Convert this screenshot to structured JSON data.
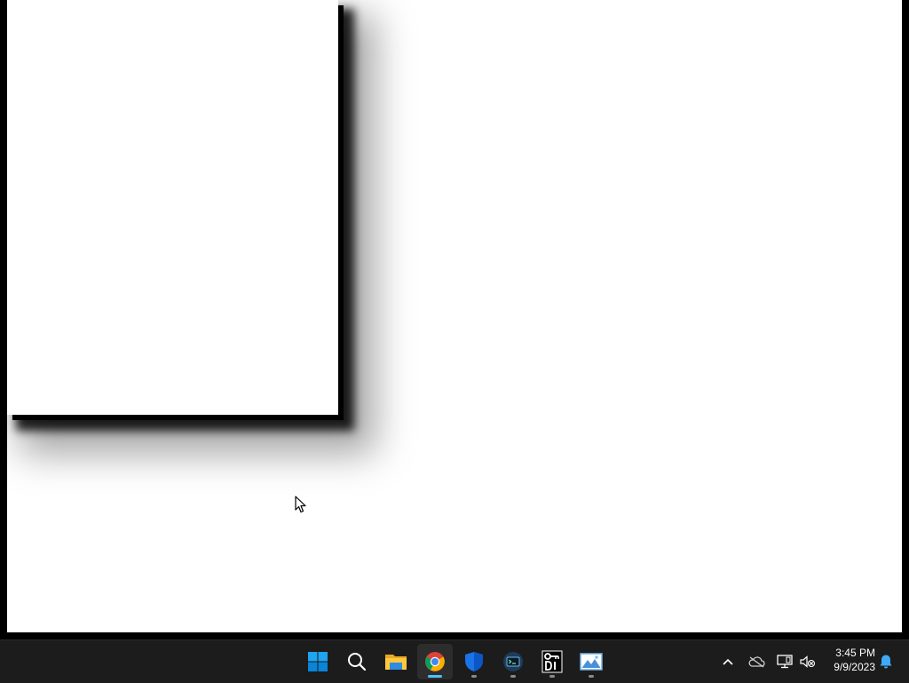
{
  "taskbar": {
    "apps": [
      {
        "name": "Start",
        "icon": "windows-start-icon",
        "state": "idle"
      },
      {
        "name": "Search",
        "icon": "search-icon",
        "state": "idle"
      },
      {
        "name": "File Explorer",
        "icon": "folder-icon",
        "state": "idle"
      },
      {
        "name": "Google Chrome",
        "icon": "chrome-icon",
        "state": "focused"
      },
      {
        "name": "Windows Security",
        "icon": "shield-icon",
        "state": "running"
      },
      {
        "name": "Terminal app",
        "icon": "terminal-icon",
        "state": "running"
      },
      {
        "name": "Key app",
        "icon": "key-di-icon",
        "state": "running"
      },
      {
        "name": "Photos",
        "icon": "photos-icon",
        "state": "running"
      }
    ],
    "tray": {
      "icons": [
        "chevron-up-icon",
        "onedrive-icon",
        "network-icon",
        "volume-muted-icon"
      ],
      "time": "3:45 PM",
      "date": "9/9/2023",
      "notification_icon": "bell-icon"
    }
  },
  "colors": {
    "taskbar_bg": "#1c1c1c",
    "focused_indicator": "#4cc2ff",
    "start_blue": "#0078d4"
  }
}
